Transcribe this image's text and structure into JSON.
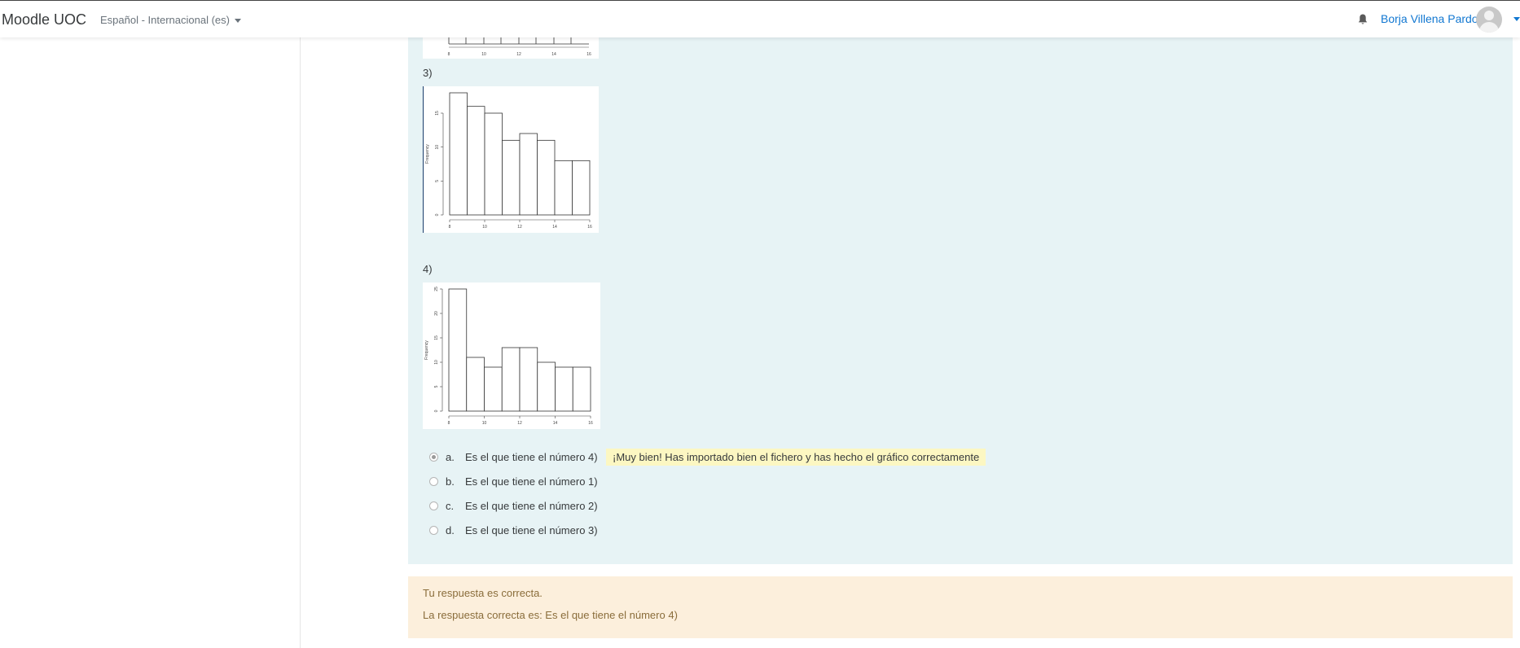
{
  "navbar": {
    "brand": "Moodle UOC",
    "language": "Español - Internacional (es)",
    "username": "Borja Villena Pardo",
    "icons": [
      "bell-icon",
      "avatar",
      "chevron-down-icon"
    ]
  },
  "question": {
    "option_labels": [
      "3)",
      "4)"
    ],
    "answers": [
      {
        "letter": "a.",
        "text": "Es el que tiene el número 4)",
        "selected": true,
        "feedback": "¡Muy bien! Has importado bien el fichero y has hecho el gráfico correctamente"
      },
      {
        "letter": "b.",
        "text": "Es el que tiene el número 1)",
        "selected": false
      },
      {
        "letter": "c.",
        "text": "Es el que tiene el número 2)",
        "selected": false
      },
      {
        "letter": "d.",
        "text": "Es el que tiene el número 3)",
        "selected": false
      }
    ]
  },
  "outcome": {
    "result": "Tu respuesta es correcta.",
    "correct_answer": "La respuesta correcta es: Es el que tiene el número 4)"
  },
  "chart_data": [
    {
      "type": "bar",
      "ylabel": "Frequency",
      "xticks": [
        "8",
        "10",
        "12",
        "14",
        "16"
      ],
      "yticks": [
        "0",
        "5",
        "10",
        "15"
      ],
      "bins": [
        8,
        9,
        10,
        11,
        12,
        13,
        14,
        15,
        16
      ],
      "values": [
        18,
        16,
        15,
        11,
        12,
        11,
        8,
        8
      ],
      "ylim": [
        0,
        18
      ]
    },
    {
      "type": "bar",
      "ylabel": "Frequency",
      "xticks": [
        "8",
        "10",
        "12",
        "14",
        "16"
      ],
      "yticks": [
        "0",
        "5",
        "10",
        "15",
        "20",
        "25"
      ],
      "bins": [
        8,
        9,
        10,
        11,
        12,
        13,
        14,
        15,
        16
      ],
      "values": [
        25,
        11,
        9,
        13,
        13,
        10,
        9,
        9
      ],
      "ylim": [
        0,
        25
      ]
    }
  ]
}
